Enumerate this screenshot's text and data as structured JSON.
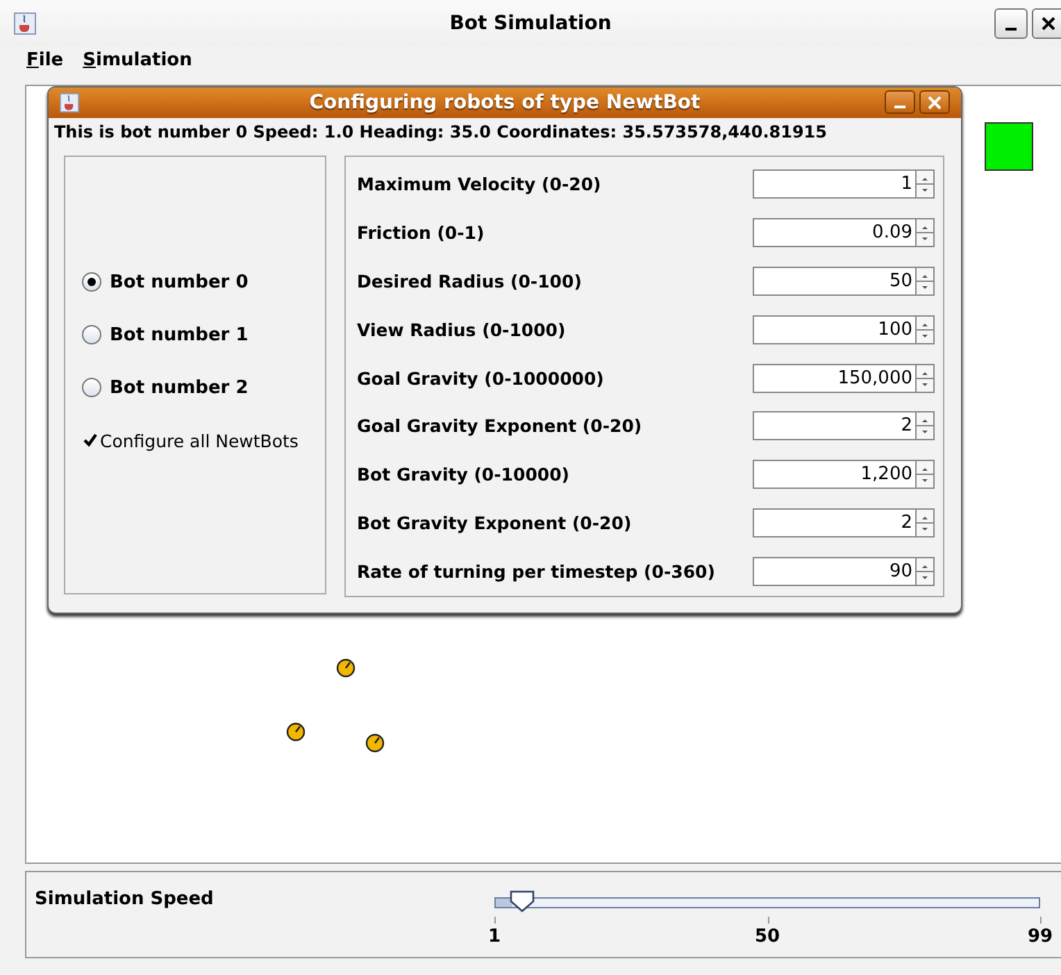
{
  "window": {
    "title": "Bot Simulation"
  },
  "menu": [
    {
      "label": "File"
    },
    {
      "label": "Simulation"
    }
  ],
  "dialog": {
    "title": "Configuring robots of type NewtBot",
    "info": "This is bot number 0  Speed: 1.0  Heading: 35.0  Coordinates: 35.573578,440.81915",
    "bots": [
      {
        "label": "Bot number 0",
        "selected": true
      },
      {
        "label": "Bot number 1",
        "selected": false
      },
      {
        "label": "Bot number 2",
        "selected": false
      }
    ],
    "configure_all": {
      "label": "Configure all NewtBots",
      "checked": true
    },
    "params": [
      {
        "label": "Maximum Velocity (0-20)",
        "value": "1"
      },
      {
        "label": "Friction (0-1)",
        "value": "0.09"
      },
      {
        "label": "Desired Radius (0-100)",
        "value": "50"
      },
      {
        "label": "View Radius (0-1000)",
        "value": "100"
      },
      {
        "label": "Goal Gravity (0-1000000)",
        "value": "150,000"
      },
      {
        "label": "Goal Gravity Exponent (0-20)",
        "value": "2"
      },
      {
        "label": "Bot Gravity (0-10000)",
        "value": "1,200"
      },
      {
        "label": "Bot Gravity Exponent (0-20)",
        "value": "2"
      },
      {
        "label": "Rate of turning per timestep (0-360)",
        "value": "90"
      }
    ]
  },
  "speed": {
    "label": "Simulation Speed",
    "level": 0.03,
    "ticks": [
      "1",
      "50",
      "99"
    ]
  }
}
